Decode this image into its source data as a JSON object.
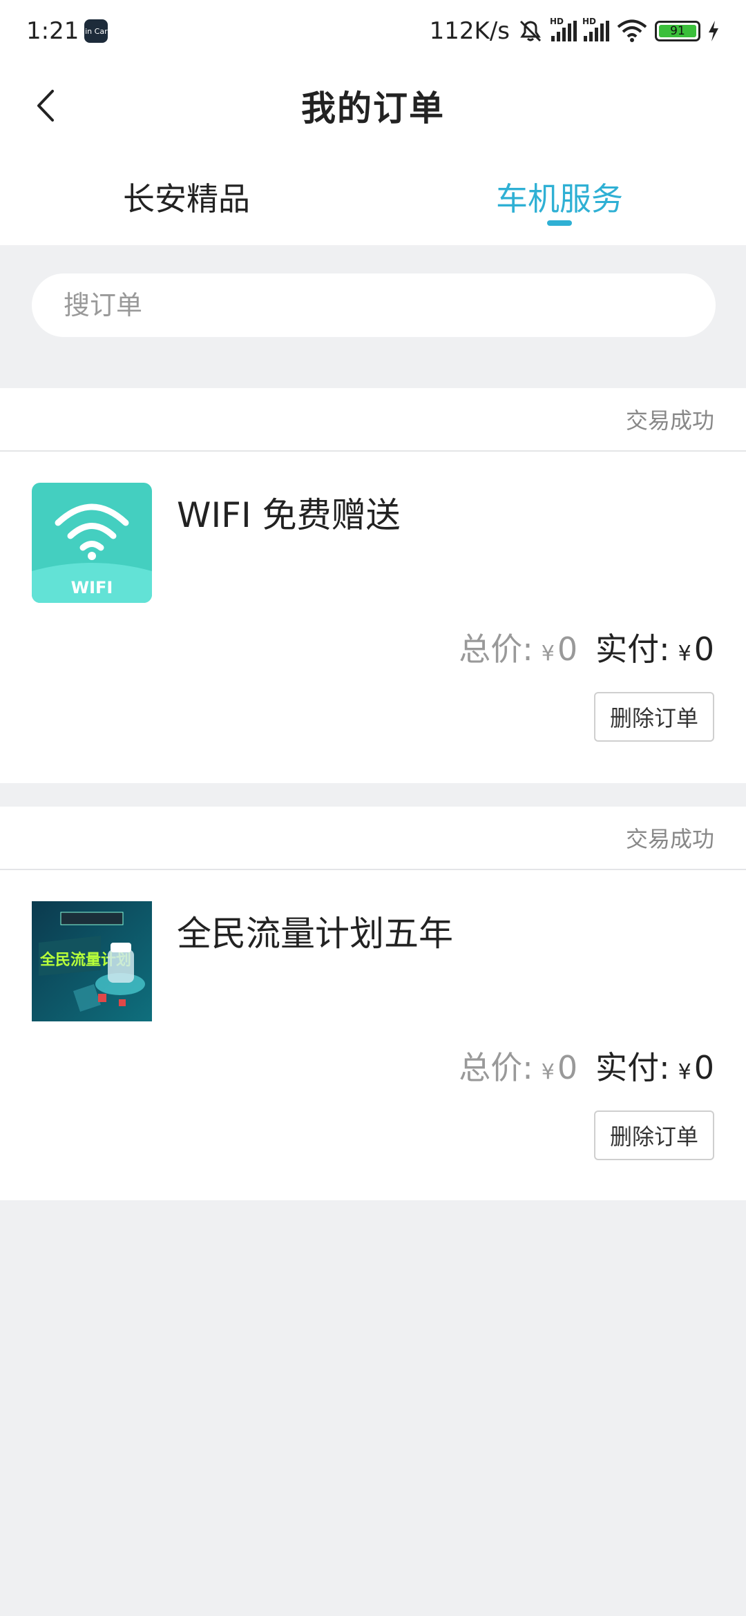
{
  "status_bar": {
    "time": "1:21",
    "app_badge": "in Car",
    "net_speed": "112K/s",
    "signal1_label": "HD",
    "signal2_label": "HD",
    "battery": "91"
  },
  "header": {
    "title": "我的订单",
    "back_icon": "chevron-left-icon"
  },
  "tabs": [
    {
      "label": "长安精品",
      "active": false
    },
    {
      "label": "车机服务",
      "active": true
    }
  ],
  "search": {
    "placeholder": "搜订单"
  },
  "orders": [
    {
      "status": "交易成功",
      "name": "WIFI 免费赠送",
      "thumb_label": "WIFI",
      "total_label": "总价:",
      "currency": "¥",
      "total": "0",
      "paid_label": "实付:",
      "paid": "0",
      "delete_label": "删除订单"
    },
    {
      "status": "交易成功",
      "name": "全民流量计划五年",
      "thumb_label": "全民流量计划",
      "total_label": "总价:",
      "currency": "¥",
      "total": "0",
      "paid_label": "实付:",
      "paid": "0",
      "delete_label": "删除订单"
    }
  ],
  "colors": {
    "accent": "#2fb0d4",
    "background": "#eff0f2"
  }
}
